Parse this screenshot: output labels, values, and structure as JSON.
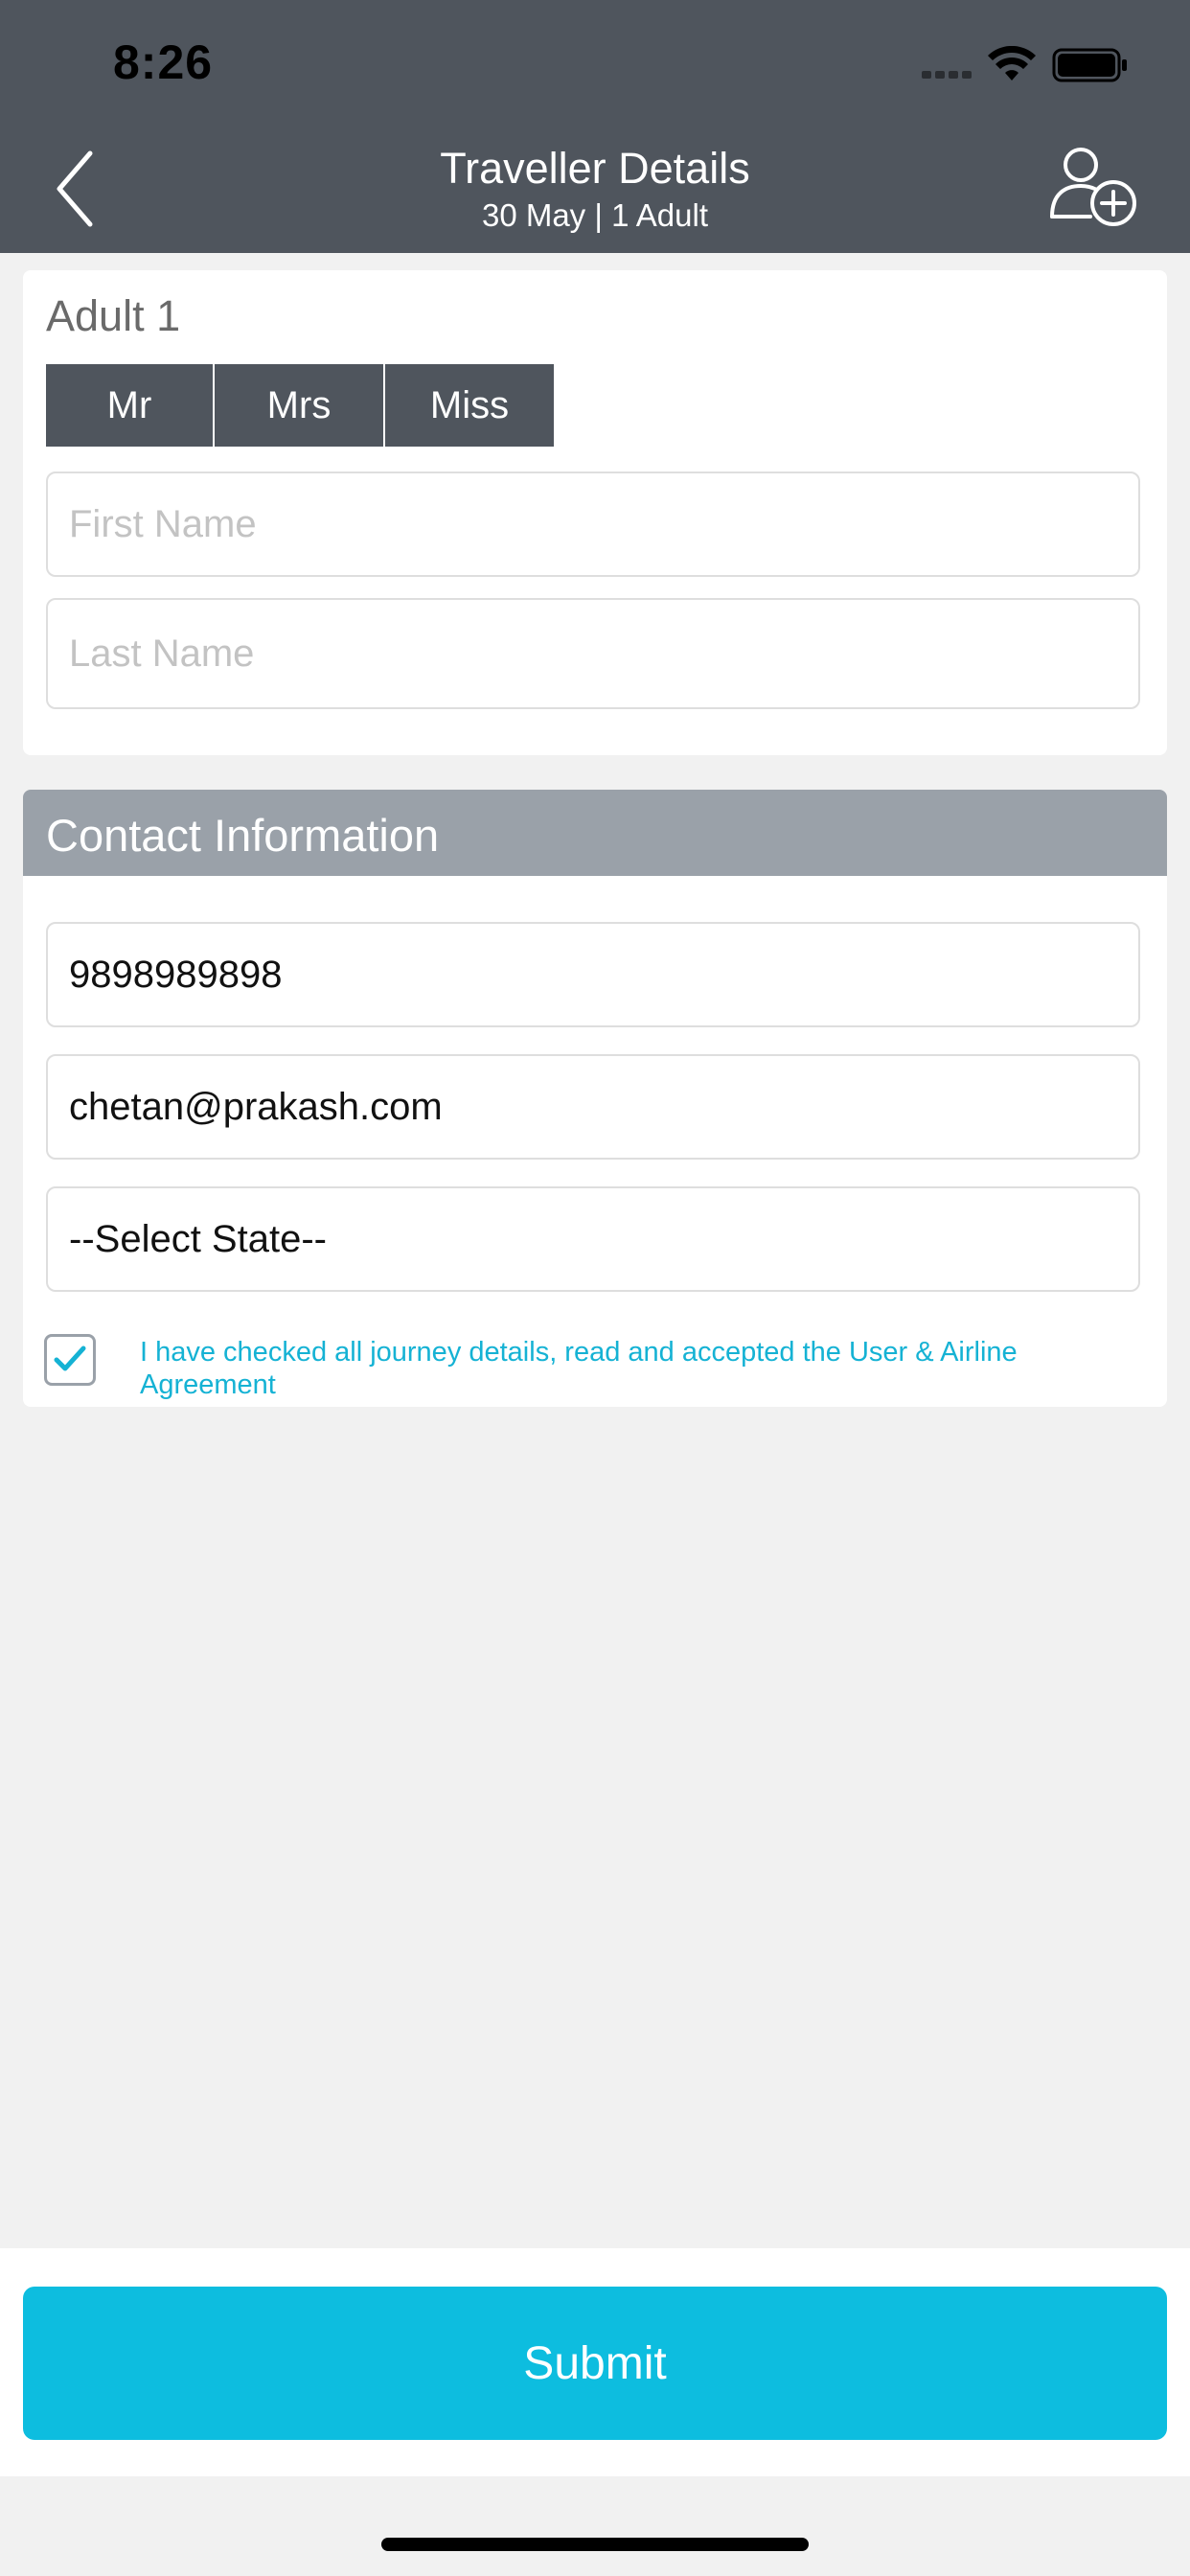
{
  "status_bar": {
    "time": "8:26"
  },
  "header": {
    "title": "Traveller Details",
    "subtitle": "30 May | 1 Adult",
    "back_icon": "chevron-left-icon",
    "add_user_icon": "add-user-icon",
    "background_color": "#4f555d"
  },
  "adult": {
    "label": "Adult 1",
    "salutations": [
      "Mr",
      "Mrs",
      "Miss"
    ],
    "first_name": {
      "placeholder": "First Name",
      "value": ""
    },
    "last_name": {
      "placeholder": "Last Name",
      "value": ""
    }
  },
  "contact": {
    "heading": "Contact Information",
    "phone": "9898989898",
    "email": "chetan@prakash.com",
    "state_select": "--Select State--",
    "agreement_checked": true,
    "agreement_text": "I have checked all journey details, read and accepted the User & Airline Agreement"
  },
  "footer": {
    "submit_label": "Submit",
    "accent_color": "#0dbddf"
  }
}
